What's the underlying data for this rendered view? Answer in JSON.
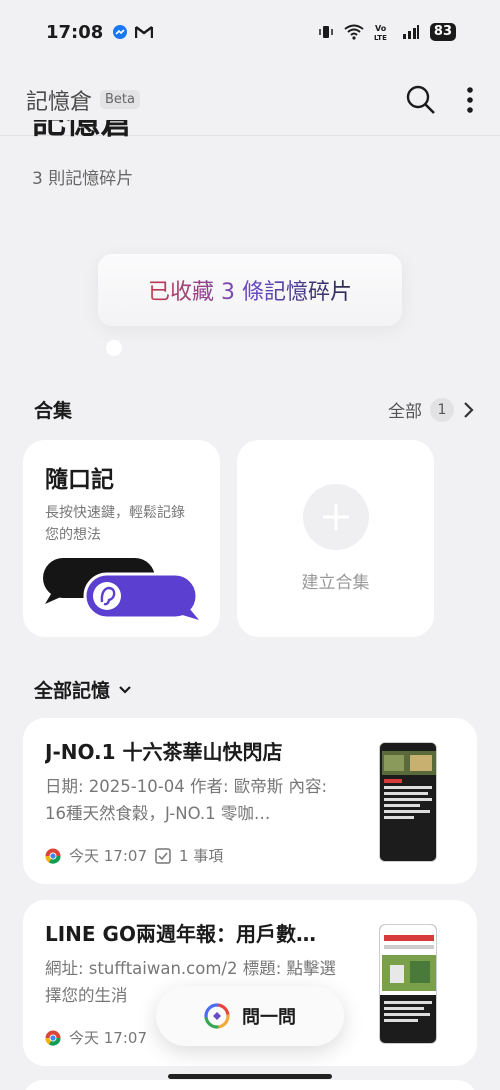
{
  "status_bar": {
    "time": "17:08",
    "battery": "83"
  },
  "app_bar": {
    "title": "記憶倉",
    "badge": "Beta"
  },
  "header": {
    "title_partial": "記憶倉",
    "count_text": "3 則記憶碎片"
  },
  "toast": {
    "text": "已收藏 3 條記憶碎片"
  },
  "collections": {
    "heading": "合集",
    "all_label": "全部",
    "all_count": "1",
    "items": [
      {
        "title": "隨口記",
        "desc": "長按快速鍵，輕鬆記錄您的想法"
      }
    ],
    "create_label": "建立合集"
  },
  "memories": {
    "filter_label": "全部記憶",
    "items": [
      {
        "title": "J-NO.1 十六茶華山快閃店",
        "body": "日期: 2025-10-04 作者: 歐帝斯 內容: 16種天然食穀，J-NO.1 零咖…",
        "time": "今天 17:07",
        "tasks": "1 事項"
      },
      {
        "title": "LINE GO兩週年報：用戶數…",
        "body": "網址: stufftaiwan.com/2 標題: 點擊選擇您的生消",
        "time": "今天 17:07"
      }
    ]
  },
  "ask_button": {
    "label": "問一問"
  },
  "colors": {
    "accent": "#5b3fd1",
    "background": "#f1f1f3"
  }
}
